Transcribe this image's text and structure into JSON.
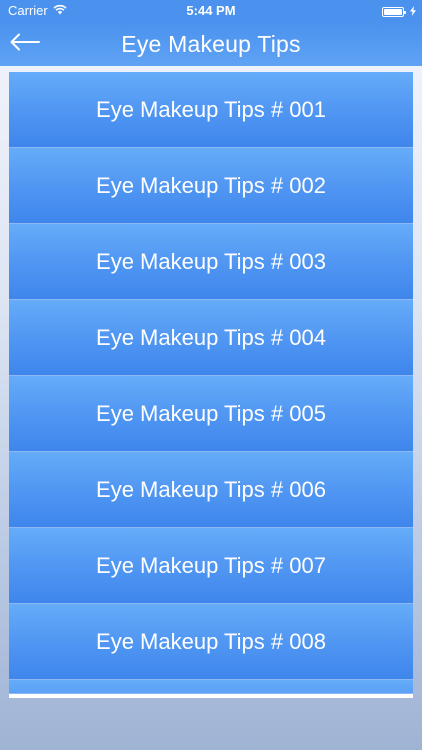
{
  "status_bar": {
    "carrier": "Carrier",
    "time": "5:44 PM",
    "wifi_icon": "wifi-icon",
    "battery_icon": "battery-icon",
    "charging_icon": "bolt-icon"
  },
  "header": {
    "back_icon": "arrow-left-icon",
    "title": "Eye Makeup Tips"
  },
  "list": {
    "items": [
      {
        "label": "Eye Makeup Tips # 001"
      },
      {
        "label": "Eye Makeup Tips # 002"
      },
      {
        "label": "Eye Makeup Tips # 003"
      },
      {
        "label": "Eye Makeup Tips # 004"
      },
      {
        "label": "Eye Makeup Tips # 005"
      },
      {
        "label": "Eye Makeup Tips # 006"
      },
      {
        "label": "Eye Makeup Tips # 007"
      },
      {
        "label": "Eye Makeup Tips # 008"
      }
    ]
  },
  "colors": {
    "accent": "#4a92ee",
    "item_top": "#65acf9",
    "item_bottom": "#3f86ec",
    "text": "#ffffff"
  }
}
